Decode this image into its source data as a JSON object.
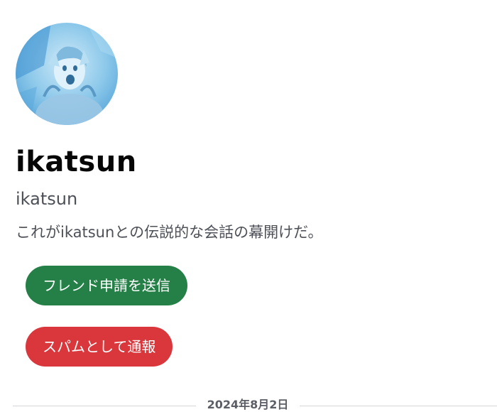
{
  "colors": {
    "accent_green": "#248046",
    "accent_red": "#da373c"
  },
  "profile": {
    "avatar_icon": "user-avatar-image",
    "display_name": "ikatsun",
    "username": "ikatsun",
    "intro_text": "これがikatsunとの伝説的な会話の幕開けだ。"
  },
  "actions": {
    "friend_request_label": "フレンド申請を送信",
    "report_spam_label": "スパムとして通報"
  },
  "divider": {
    "date": "2024年8月2日"
  }
}
